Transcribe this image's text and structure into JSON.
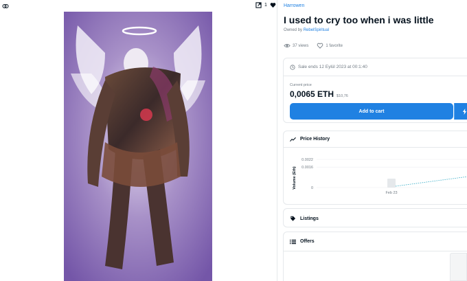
{
  "header": {
    "favorites_count": "1"
  },
  "item": {
    "collection": "Harrowen",
    "title": "I used to cry too when i was little",
    "owned_prefix": "Owned by ",
    "owner": "RebelSpiritual",
    "views": "37 views",
    "favorites": "1 favorite"
  },
  "sale": {
    "ends_text": "Sale ends 12 Eylül 2023 at 00:1:40",
    "current_price_label": "Current price",
    "price": "0,0065 ETH",
    "price_usd": "$10,76",
    "add_to_cart_label": "Add to cart"
  },
  "price_history": {
    "title": "Price History"
  },
  "chart_data": {
    "type": "bar",
    "ylabel": "Volume (Eth)",
    "yticks": [
      "0.0022",
      "0.0016",
      "0"
    ],
    "categories": [
      "Feb 23"
    ],
    "values": [
      0.0007
    ],
    "ylim": [
      0,
      0.0022
    ]
  },
  "listings": {
    "title": "Listings"
  },
  "offers": {
    "title": "Offers"
  },
  "colors": {
    "accent": "#2081e2",
    "text": "#04111d",
    "muted": "#707a83",
    "border": "#e5e8eb"
  }
}
